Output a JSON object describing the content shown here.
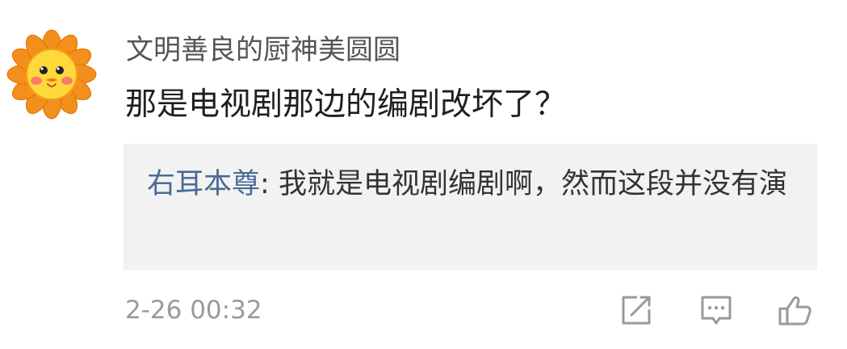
{
  "comment": {
    "username": "文明善良的厨神美圆圆",
    "text": "那是电视剧那边的编剧改坏了？",
    "reply": {
      "author": "右耳本尊",
      "separator": ": ",
      "text": "我就是电视剧编剧啊，然而这段并没有演"
    },
    "timestamp": "2-26 00:32"
  },
  "actions": {
    "share_icon": "share-icon",
    "comment_icon": "comment-icon",
    "like_icon": "thumbs-up-icon"
  },
  "colors": {
    "username": "#555555",
    "text": "#1f1f1f",
    "reply_background": "#f2f2f2",
    "reply_author": "#4a6b96",
    "timestamp": "#9a9a9a",
    "icon": "#9a9a9a",
    "avatar_petals": "#f38f1c",
    "avatar_face": "#ffd93b"
  }
}
